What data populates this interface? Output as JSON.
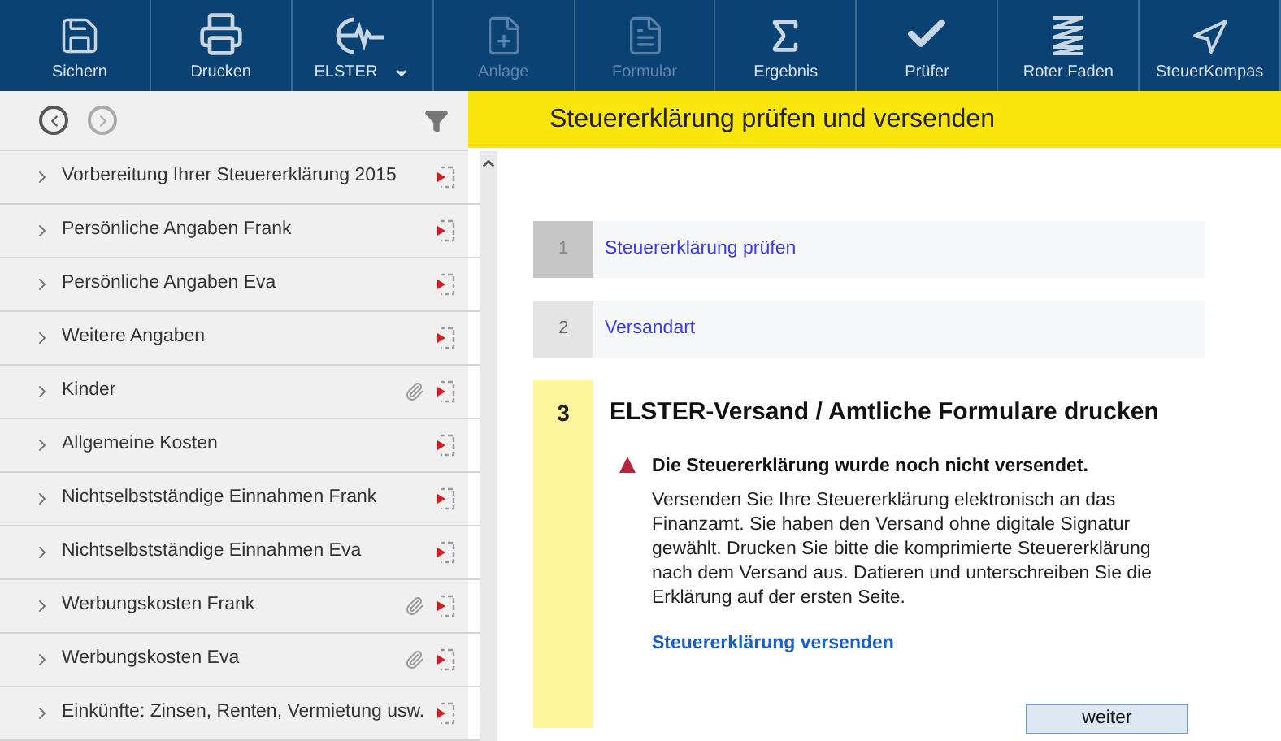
{
  "toolbar": [
    {
      "kind": "save",
      "label": "Sichern",
      "disabled": false,
      "dropdown": false
    },
    {
      "kind": "print",
      "label": "Drucken",
      "disabled": false,
      "dropdown": false
    },
    {
      "kind": "elster",
      "label": "ELSTER",
      "disabled": false,
      "dropdown": true
    },
    {
      "kind": "attach",
      "label": "Anlage",
      "disabled": true,
      "dropdown": false
    },
    {
      "kind": "form",
      "label": "Formular",
      "disabled": true,
      "dropdown": false
    },
    {
      "kind": "sum",
      "label": "Ergebnis",
      "disabled": false,
      "dropdown": false
    },
    {
      "kind": "check",
      "label": "Prüfer",
      "disabled": false,
      "dropdown": false
    },
    {
      "kind": "thread",
      "label": "Roter Faden",
      "disabled": false,
      "dropdown": false
    },
    {
      "kind": "compass",
      "label": "SteuerKompas",
      "disabled": false,
      "dropdown": false
    }
  ],
  "sidebar": {
    "items": [
      {
        "label": "Vorbereitung Ihrer Steuererklärung 2015",
        "attachment": false
      },
      {
        "label": "Persönliche Angaben Frank",
        "attachment": false
      },
      {
        "label": "Persönliche Angaben Eva",
        "attachment": false
      },
      {
        "label": "Weitere Angaben",
        "attachment": false
      },
      {
        "label": "Kinder",
        "attachment": true
      },
      {
        "label": "Allgemeine Kosten",
        "attachment": false
      },
      {
        "label": "Nichtselbstständige Einnahmen Frank",
        "attachment": false
      },
      {
        "label": "Nichtselbstständige Einnahmen Eva",
        "attachment": false
      },
      {
        "label": "Werbungskosten Frank",
        "attachment": true
      },
      {
        "label": "Werbungskosten Eva",
        "attachment": true
      },
      {
        "label": "Einkünfte: Zinsen, Renten, Vermietung usw.",
        "attachment": false
      }
    ]
  },
  "main": {
    "title": "Steuererklärung prüfen und versenden",
    "steps": [
      {
        "number": "1",
        "title": "Steuererklärung prüfen",
        "completed": true,
        "selected": false
      },
      {
        "number": "2",
        "title": "Versandart",
        "completed": false,
        "selected": false
      },
      {
        "number": "3",
        "title": "ELSTER-Versand / Amtliche Formulare drucken",
        "selected": true
      }
    ],
    "warning": "Die Steuererklärung wurde noch nicht versendet.",
    "description": "Versenden Sie Ihre Steuererklärung elektronisch an das Finanzamt. Sie haben den Versand ohne digitale Signatur gewählt. Drucken Sie bitte die komprimierte Steuererklärung nach dem Versand aus. Datieren und unterschreiben Sie die Erklärung auf der ersten Seite.",
    "link": "Steuererklärung versenden",
    "button": "weiter"
  }
}
